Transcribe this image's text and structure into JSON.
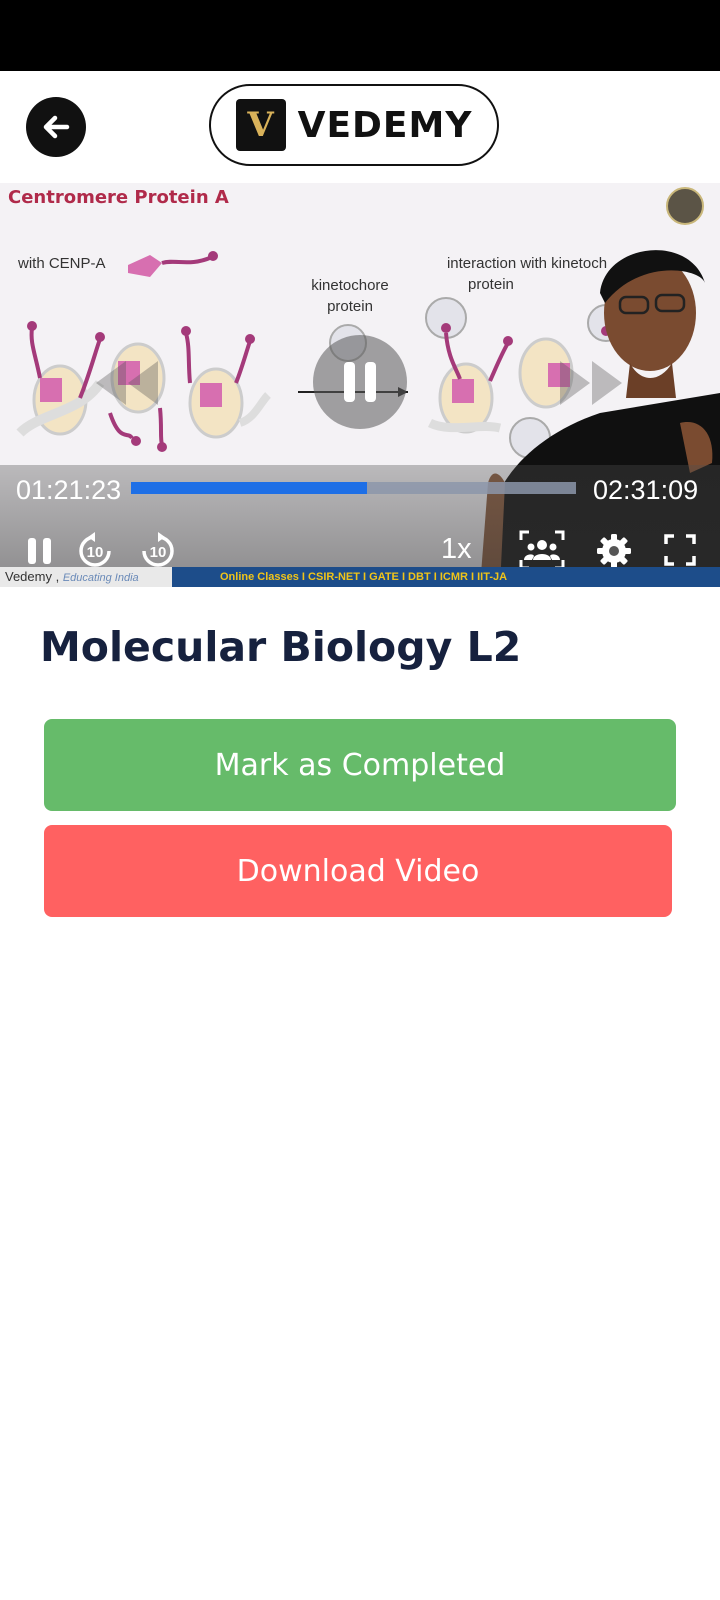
{
  "header": {
    "logo_letter": "V",
    "logo_text": "VEDEMY",
    "icons": {
      "back": "arrow-left-icon"
    }
  },
  "player": {
    "slide": {
      "title": "Centromere Protein A",
      "label_cenp": "with CENP-A",
      "label_kinetochore_line1": "kinetochore",
      "label_kinetochore_line2": "protein",
      "label_interaction_line1": "interaction with kinetoch",
      "label_interaction_line2": "protein",
      "footer_brand": "Vedemy ,",
      "footer_tagline": "Educating India",
      "footer_courses": "Online Classes I CSIR-NET I GATE I DBT I ICMR I IIT-JA"
    },
    "current_time": "01:21:23",
    "total_time": "02:31:09",
    "progress": 0.53,
    "speed": "1x",
    "rewind_seconds": "10",
    "forward_seconds": "10",
    "icons": {
      "pause": "pause-icon",
      "rewind": "rewind-10-icon",
      "forward": "forward-10-icon",
      "watch_party": "group-icon",
      "settings": "gear-icon",
      "fullscreen": "fullscreen-icon"
    }
  },
  "video": {
    "title": "Molecular Biology L2"
  },
  "actions": {
    "mark_completed": "Mark as Completed",
    "download": "Download Video"
  },
  "colors": {
    "progress": "#1e6fe6",
    "mark_completed_bg": "#66bb6a",
    "download_bg": "#ff6161",
    "title": "#16213e"
  }
}
